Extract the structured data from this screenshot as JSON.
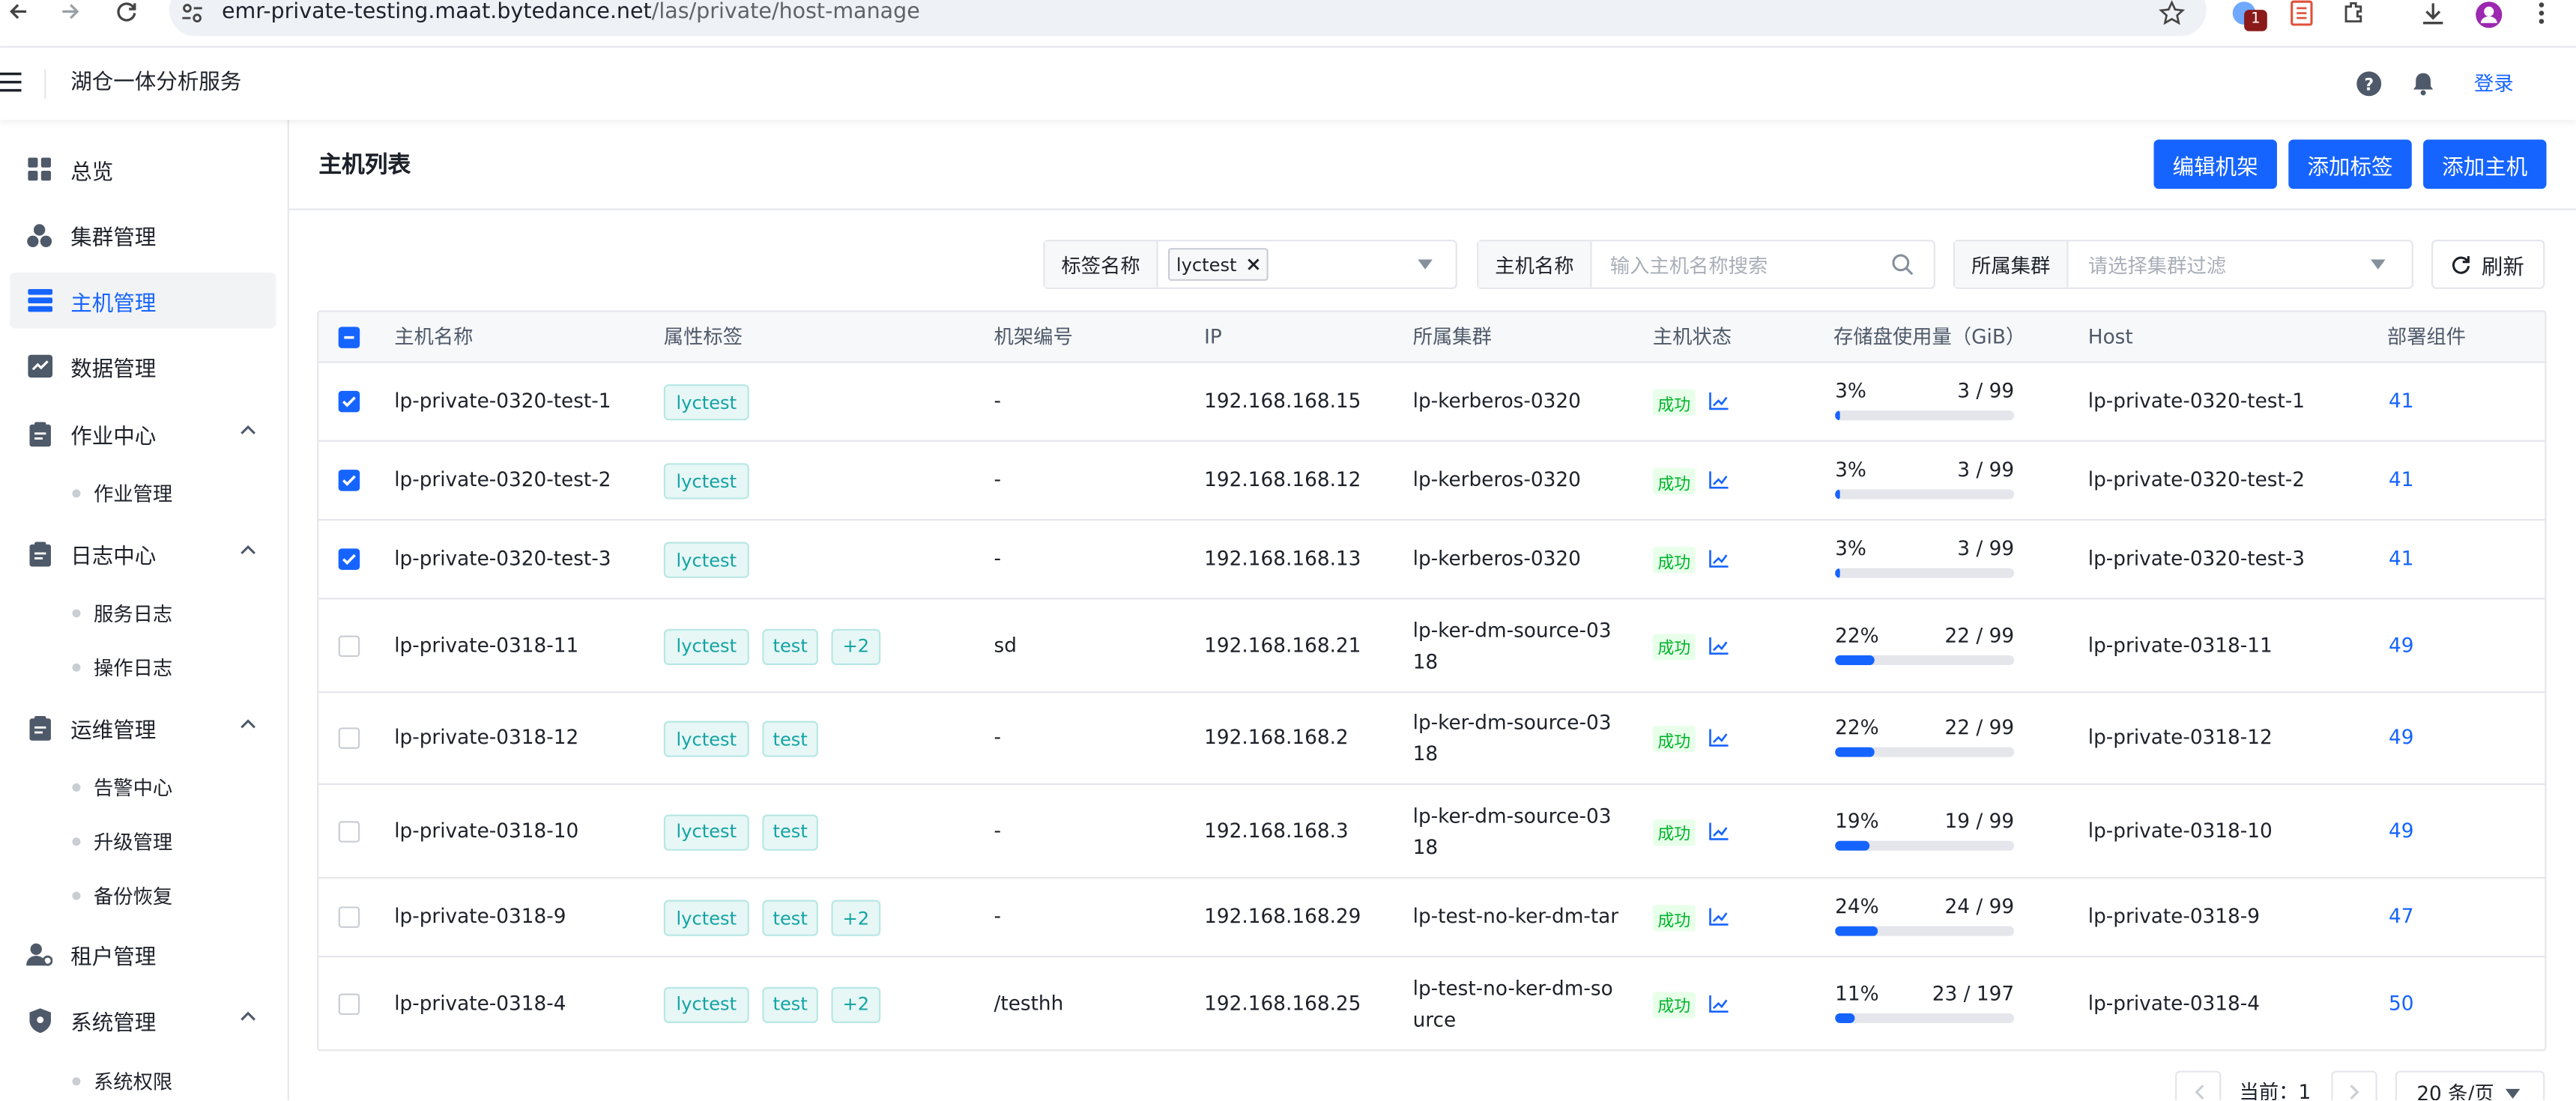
{
  "browser": {
    "url_host": "emr-private-testing.maat.bytedance.net",
    "url_path": "/las/private/host-manage",
    "ext_badge": "1"
  },
  "app": {
    "title": "湖仓一体分析服务",
    "login": "登录"
  },
  "sidebar": {
    "items": [
      {
        "label": "总览"
      },
      {
        "label": "集群管理"
      },
      {
        "label": "主机管理"
      },
      {
        "label": "数据管理"
      },
      {
        "label": "作业中心"
      },
      {
        "label": "作业管理"
      },
      {
        "label": "日志中心"
      },
      {
        "label": "服务日志"
      },
      {
        "label": "操作日志"
      },
      {
        "label": "运维管理"
      },
      {
        "label": "告警中心"
      },
      {
        "label": "升级管理"
      },
      {
        "label": "备份恢复"
      },
      {
        "label": "租户管理"
      },
      {
        "label": "系统管理"
      },
      {
        "label": "系统权限"
      }
    ]
  },
  "page": {
    "title": "主机列表",
    "buttons": {
      "edit_rack": "编辑机架",
      "add_tag": "添加标签",
      "add_host": "添加主机"
    }
  },
  "filters": {
    "tag_label": "标签名称",
    "tag_value": "lyctest",
    "host_label": "主机名称",
    "host_placeholder": "输入主机名称搜索",
    "cluster_label": "所属集群",
    "cluster_placeholder": "请选择集群过滤",
    "refresh": "刷新"
  },
  "table": {
    "columns": [
      "主机名称",
      "属性标签",
      "机架编号",
      "IP",
      "所属集群",
      "主机状态",
      "存储盘使用量（GiB）",
      "Host",
      "部署组件"
    ],
    "rows": [
      {
        "name": "lp-private-0320-test-1",
        "tags": [
          "lyctest"
        ],
        "rack": "-",
        "ip": "192.168.168.15",
        "cluster1": "lp-kerberos-0320",
        "cluster2": "",
        "status": "成功",
        "pct": "3%",
        "usage": "3 / 99",
        "ratio": 0.03,
        "host": "lp-private-0320-test-1",
        "comp": "41",
        "checked": true
      },
      {
        "name": "lp-private-0320-test-2",
        "tags": [
          "lyctest"
        ],
        "rack": "-",
        "ip": "192.168.168.12",
        "cluster1": "lp-kerberos-0320",
        "cluster2": "",
        "status": "成功",
        "pct": "3%",
        "usage": "3 / 99",
        "ratio": 0.03,
        "host": "lp-private-0320-test-2",
        "comp": "41",
        "checked": true
      },
      {
        "name": "lp-private-0320-test-3",
        "tags": [
          "lyctest"
        ],
        "rack": "-",
        "ip": "192.168.168.13",
        "cluster1": "lp-kerberos-0320",
        "cluster2": "",
        "status": "成功",
        "pct": "3%",
        "usage": "3 / 99",
        "ratio": 0.03,
        "host": "lp-private-0320-test-3",
        "comp": "41",
        "checked": true
      },
      {
        "name": "lp-private-0318-11",
        "tags": [
          "lyctest",
          "test",
          "+2"
        ],
        "rack": "sd",
        "ip": "192.168.168.21",
        "cluster1": "lp-ker-dm-source-03",
        "cluster2": "18",
        "status": "成功",
        "pct": "22%",
        "usage": "22 / 99",
        "ratio": 0.22,
        "host": "lp-private-0318-11",
        "comp": "49",
        "checked": false
      },
      {
        "name": "lp-private-0318-12",
        "tags": [
          "lyctest",
          "test"
        ],
        "rack": "-",
        "ip": "192.168.168.2",
        "cluster1": "lp-ker-dm-source-03",
        "cluster2": "18",
        "status": "成功",
        "pct": "22%",
        "usage": "22 / 99",
        "ratio": 0.22,
        "host": "lp-private-0318-12",
        "comp": "49",
        "checked": false
      },
      {
        "name": "lp-private-0318-10",
        "tags": [
          "lyctest",
          "test"
        ],
        "rack": "-",
        "ip": "192.168.168.3",
        "cluster1": "lp-ker-dm-source-03",
        "cluster2": "18",
        "status": "成功",
        "pct": "19%",
        "usage": "19 / 99",
        "ratio": 0.19,
        "host": "lp-private-0318-10",
        "comp": "49",
        "checked": false
      },
      {
        "name": "lp-private-0318-9",
        "tags": [
          "lyctest",
          "test",
          "+2"
        ],
        "rack": "-",
        "ip": "192.168.168.29",
        "cluster1": "lp-test-no-ker-dm-tar",
        "cluster2": "",
        "status": "成功",
        "pct": "24%",
        "usage": "24 / 99",
        "ratio": 0.24,
        "host": "lp-private-0318-9",
        "comp": "47",
        "checked": false
      },
      {
        "name": "lp-private-0318-4",
        "tags": [
          "lyctest",
          "test",
          "+2"
        ],
        "rack": "/testhh",
        "ip": "192.168.168.25",
        "cluster1": "lp-test-no-ker-dm-so",
        "cluster2": "urce",
        "status": "成功",
        "pct": "11%",
        "usage": "23 / 197",
        "ratio": 0.11,
        "host": "lp-private-0318-4",
        "comp": "50",
        "checked": false
      }
    ]
  },
  "pagination": {
    "current": "当前：1",
    "page_size": "20 条/页"
  },
  "colors": {
    "primary": "#1664ff",
    "success": "#00b42a",
    "tag": "#14a3a3"
  }
}
